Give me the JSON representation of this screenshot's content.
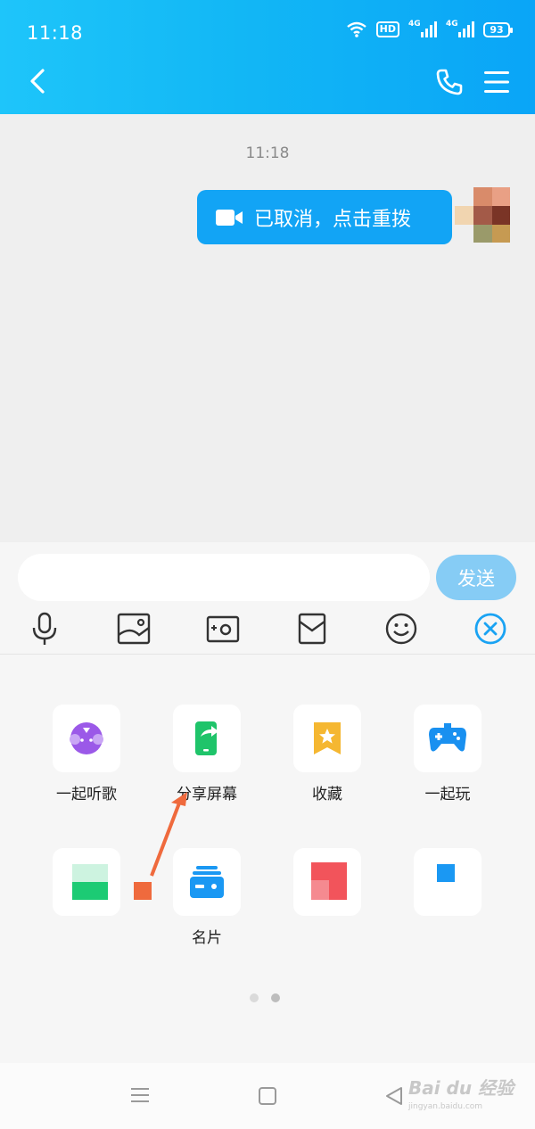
{
  "status_bar": {
    "time": "11:18",
    "hd": "HD",
    "net1": "4G",
    "net2": "4G",
    "battery": "93"
  },
  "chat": {
    "timestamp": "11:18",
    "message": "已取消，点击重拨"
  },
  "input": {
    "value": "",
    "placeholder": ""
  },
  "send_label": "发送",
  "toolbar": [
    "mic-icon",
    "image-icon",
    "camera-icon",
    "red-packet-icon",
    "emoji-icon",
    "close-icon"
  ],
  "apps_row1": [
    {
      "label": "一起听歌",
      "icon": "music-together-icon"
    },
    {
      "label": "分享屏幕",
      "icon": "share-screen-icon"
    },
    {
      "label": "收藏",
      "icon": "favorites-icon"
    },
    {
      "label": "一起玩",
      "icon": "gamepad-icon"
    }
  ],
  "apps_row2": [
    {
      "label": "",
      "icon": "obscured-app-icon"
    },
    {
      "label": "名片",
      "icon": "business-card-icon"
    },
    {
      "label": "",
      "icon": "obscured-app-icon"
    },
    {
      "label": "",
      "icon": "obscured-app-icon"
    }
  ],
  "pagination": {
    "pages": 2,
    "current": 2
  },
  "watermark": {
    "main": "Bai du 经验",
    "sub": "jingyan.baidu.com"
  },
  "colors": {
    "header": "#12b7f5",
    "bubble": "#12a4f5",
    "send_disabled": "#86ccf5",
    "annotation_arrow": "#ef6a3d"
  }
}
